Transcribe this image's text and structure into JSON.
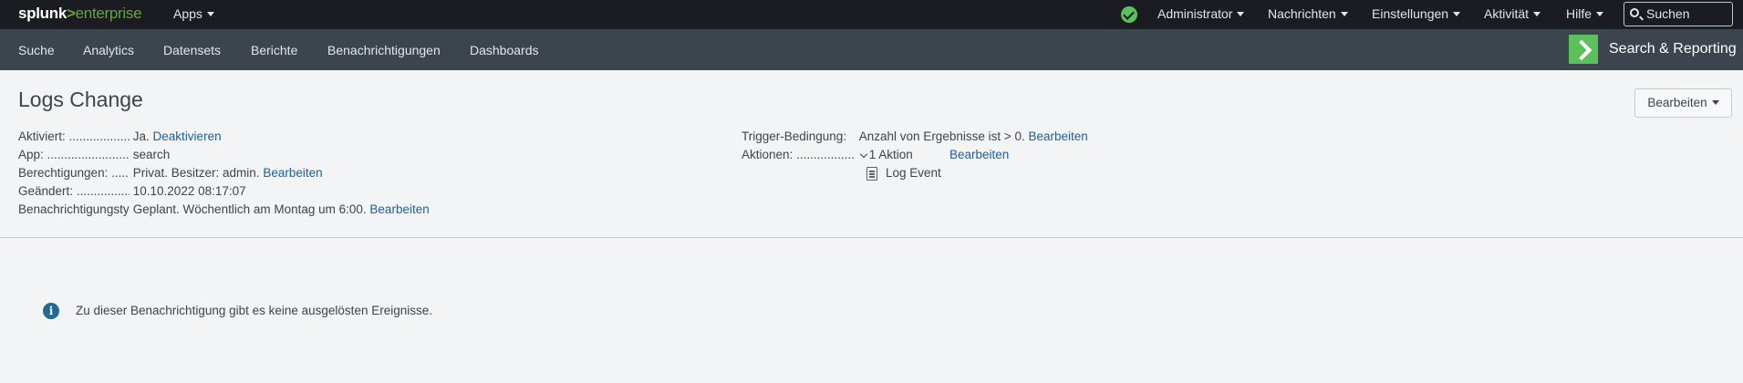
{
  "topbar": {
    "logo_splunk": "splunk",
    "logo_gt": ">",
    "logo_enterprise": "enterprise",
    "apps_label": "Apps",
    "menu": [
      "Administrator",
      "Nachrichten",
      "Einstellungen",
      "Aktivität",
      "Hilfe"
    ],
    "search_placeholder": "Suchen",
    "status_color": "#5cc05c"
  },
  "appnav": {
    "items": [
      "Suche",
      "Analytics",
      "Datensets",
      "Berichte",
      "Benachrichtigungen",
      "Dashboards"
    ],
    "app_title": "Search & Reporting",
    "accent": "#5cc05c"
  },
  "page": {
    "title": "Logs Change",
    "edit_button": "Bearbeiten"
  },
  "details_left": [
    {
      "label": "Aktiviert:",
      "value": "Ja.",
      "link": "Deaktivieren"
    },
    {
      "label": "App:",
      "value": "search",
      "link": ""
    },
    {
      "label": "Berechtigungen:",
      "value": "Privat. Besitzer: admin.",
      "link": "Bearbeiten"
    },
    {
      "label": "Geändert:",
      "value": "10.10.2022 08:17:07",
      "link": ""
    },
    {
      "label": "Benachrichtigungstyp:",
      "value": "Geplant. Wöchentlich am Montag um 6:00.",
      "link": "Bearbeiten"
    }
  ],
  "details_right": {
    "trigger_label": "Trigger-Bedingung:",
    "trigger_value": "Anzahl von Ergebnisse ist > 0.",
    "trigger_link": "Bearbeiten",
    "actions_label": "Aktionen:",
    "actions_value": "1 Aktion",
    "actions_link": "Bearbeiten",
    "action_item": "Log Event"
  },
  "empty_message": "Zu dieser Benachrichtigung gibt es keine ausgelösten Ereignisse.",
  "colors": {
    "link": "#1e5fa0",
    "topbar_bg": "#1a1c21",
    "nav_bg": "#3c444d",
    "info_icon": "#1e6c93"
  }
}
